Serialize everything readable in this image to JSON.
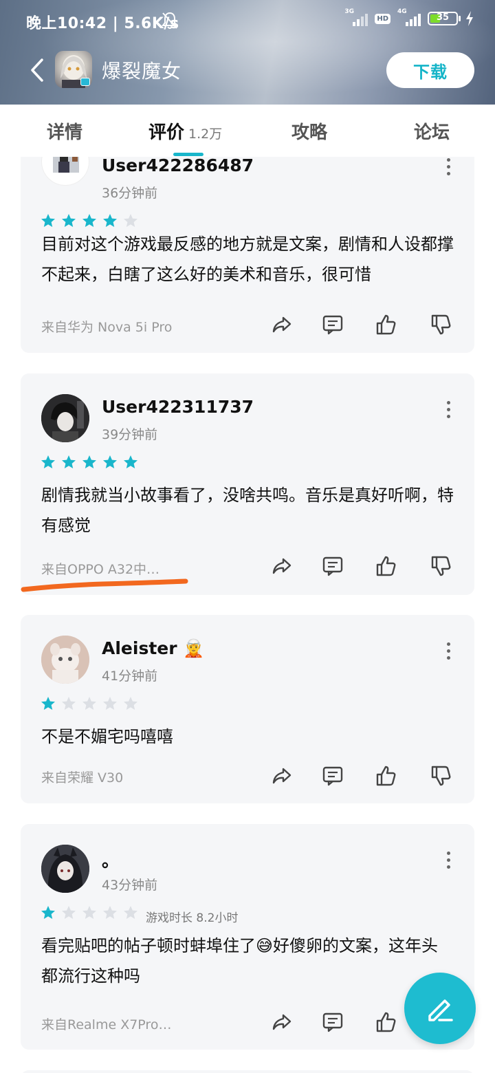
{
  "status_bar": {
    "time_speed": "晚上10:42 | 5.6K/s",
    "signal1_label": "3G",
    "hd_label": "HD",
    "signal2_label": "4G",
    "battery_level": "35"
  },
  "nav": {
    "title": "爆裂魔女",
    "download_label": "下载"
  },
  "tabs": [
    {
      "label": "详情"
    },
    {
      "label": "评价",
      "count": "1.2万",
      "active": true
    },
    {
      "label": "攻略"
    },
    {
      "label": "论坛"
    }
  ],
  "colors": {
    "accent": "#19b6cb",
    "star_filled": "#19b6cb",
    "star_empty": "#dcdfe4",
    "annotation": "#f2681f"
  },
  "reviews": [
    {
      "username": "User422286487",
      "time": "36分钟前",
      "rating": 4,
      "text": "目前对这个游戏最反感的地方就是文案，剧情和人设都撑不起来，白瞎了这么好的美术和音乐，很可惜",
      "device": "来自华为 Nova 5i Pro"
    },
    {
      "username": "User422311737",
      "time": "39分钟前",
      "rating": 5,
      "text": "剧情我就当小故事看了，没啥共鸣。音乐是真好听啊，特有感觉",
      "device": "来自OPPO A32中…"
    },
    {
      "username": "Aleister",
      "badge_emoji": "🧝",
      "time": "41分钟前",
      "rating": 1,
      "text": "不是不媚宅吗嘻嘻",
      "device": "来自荣耀 V30"
    },
    {
      "username": "。",
      "time": "43分钟前",
      "rating": 1,
      "playtime": "游戏时长 8.2小时",
      "text": "看完贴吧的帖子顿时蚌埠住了😅好傻卵的文案，这年头都流行这种吗",
      "device": "来自Realme X7Pro…"
    }
  ]
}
